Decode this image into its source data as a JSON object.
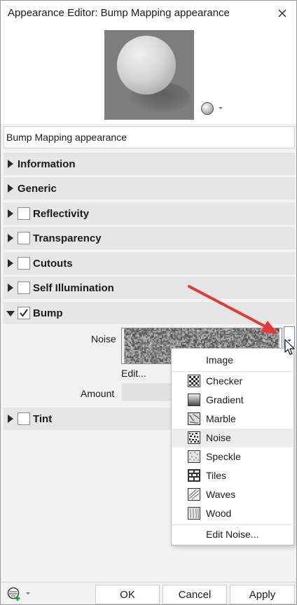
{
  "window": {
    "title": "Appearance Editor: Bump Mapping appearance",
    "close_icon": "close-icon"
  },
  "preview": {
    "shape_icon": "sphere-shape-icon"
  },
  "appearance_name": "Bump Mapping appearance",
  "sections": [
    {
      "label": "Information",
      "has_checkbox": false,
      "expanded": false
    },
    {
      "label": "Generic",
      "has_checkbox": false,
      "expanded": false
    },
    {
      "label": "Reflectivity",
      "has_checkbox": true,
      "checked": false,
      "expanded": false
    },
    {
      "label": "Transparency",
      "has_checkbox": true,
      "checked": false,
      "expanded": false
    },
    {
      "label": "Cutouts",
      "has_checkbox": true,
      "checked": false,
      "expanded": false
    },
    {
      "label": "Self Illumination",
      "has_checkbox": true,
      "checked": false,
      "expanded": false
    },
    {
      "label": "Bump",
      "has_checkbox": true,
      "checked": true,
      "expanded": true
    },
    {
      "label": "Tint",
      "has_checkbox": true,
      "checked": false,
      "expanded": false
    }
  ],
  "bump": {
    "noise_label": "Noise",
    "edit_label": "Edit...",
    "amount_label": "Amount"
  },
  "texture_menu": {
    "items": [
      {
        "label": "Image",
        "icon": "none"
      },
      {
        "label": "Checker",
        "icon": "checker-icon"
      },
      {
        "label": "Gradient",
        "icon": "gradient-icon"
      },
      {
        "label": "Marble",
        "icon": "marble-icon"
      },
      {
        "label": "Noise",
        "icon": "noise-icon",
        "highlighted": true
      },
      {
        "label": "Speckle",
        "icon": "speckle-icon"
      },
      {
        "label": "Tiles",
        "icon": "tiles-icon"
      },
      {
        "label": "Waves",
        "icon": "waves-icon"
      },
      {
        "label": "Wood",
        "icon": "wood-icon"
      }
    ],
    "edit_item": "Edit Noise..."
  },
  "footer": {
    "ok": "OK",
    "cancel": "Cancel",
    "apply": "Apply"
  },
  "colors": {
    "annotation_arrow": "#e53935",
    "section_bg": "#e6e6e6"
  }
}
